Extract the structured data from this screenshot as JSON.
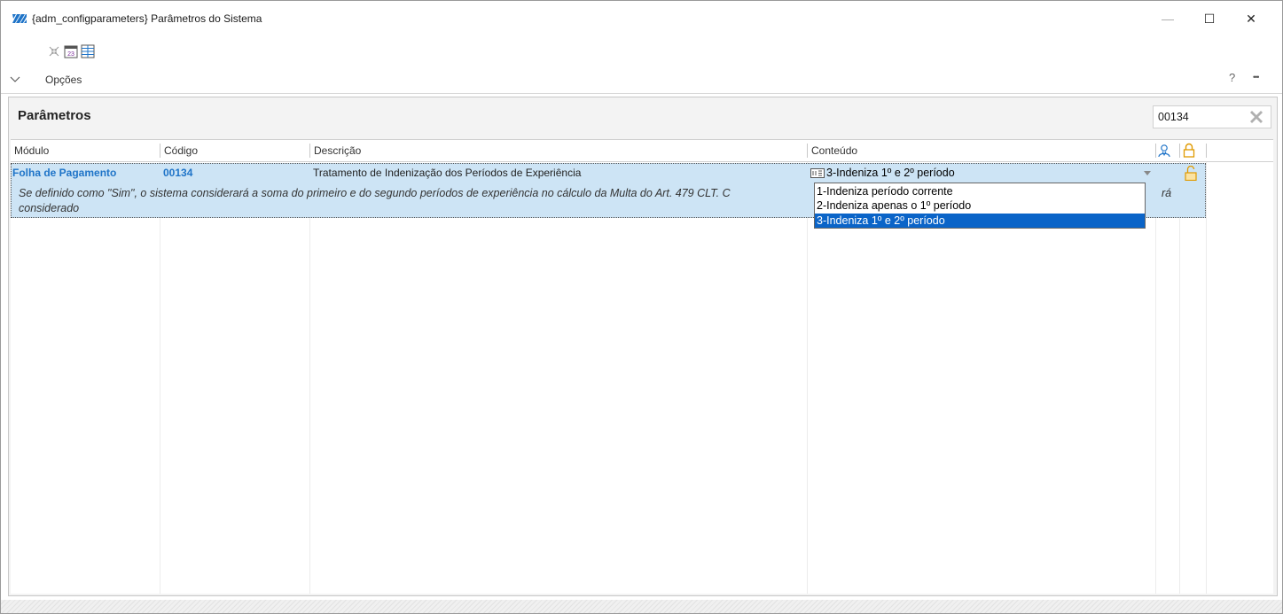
{
  "window": {
    "title": "{adm_configparameters}  Parâmetros do Sistema",
    "minimize_glyph": "—",
    "maximize_glyph": "☐",
    "close_glyph": "✕"
  },
  "options_bar": {
    "label": "Opções",
    "help_glyph": "?",
    "more_glyph": "•••"
  },
  "panel": {
    "title": "Parâmetros",
    "search_value": "00134"
  },
  "grid": {
    "columns": [
      "Módulo",
      "Código",
      "Descrição",
      "Conteúdo"
    ],
    "rows": [
      {
        "module": "Folha de Pagamento",
        "code": "00134",
        "description": "Tratamento de Indenização dos Períodos de Experiência",
        "content": "3-Indeniza 1º e 2º período",
        "help_line1": "Se definido como \"Sim\", o sistema considerará a soma do primeiro e do segundo períodos de experiência no cálculo da Multa do Art. 479 CLT. C",
        "help_line1_tail": "rá",
        "help_line2": "considerado"
      }
    ]
  },
  "dropdown": {
    "options": [
      "1-Indeniza período corrente",
      "2-Indeniza apenas o 1º período",
      "3-Indeniza 1º e 2º período"
    ],
    "selected_index": 2
  },
  "colors": {
    "accent": "#1f74c8",
    "row_selected": "#cde4f5",
    "dropdown_selected": "#0a64c8"
  }
}
